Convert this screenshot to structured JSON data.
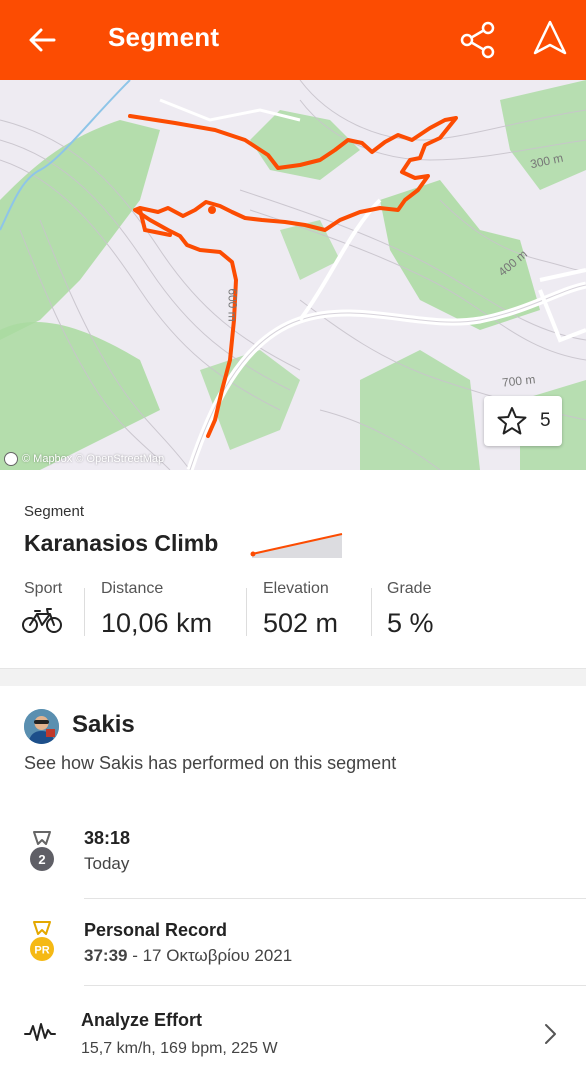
{
  "header": {
    "title": "Segment",
    "back_icon": "arrow-left-icon",
    "share_icon": "share-icon",
    "navigate_icon": "navigation-arrow-icon",
    "bg_color": "#fc4c02"
  },
  "map": {
    "contour_labels": [
      "300 m",
      "400 m",
      "600 m",
      "700 m"
    ],
    "attribution": "© Mapbox © OpenStreetMap",
    "star_count": "5",
    "route_color": "#fc4c02"
  },
  "segment": {
    "label": "Segment",
    "name": "Karanasios Climb",
    "stats": [
      {
        "label": "Sport",
        "value": ""
      },
      {
        "label": "Distance",
        "value": "10,06 km"
      },
      {
        "label": "Elevation",
        "value": "502 m"
      },
      {
        "label": "Grade",
        "value": "5 %"
      }
    ],
    "sport_icon": "bicycle-icon"
  },
  "athlete": {
    "name": "Sakis",
    "subtitle": "See how Sakis has performed on this segment"
  },
  "efforts": [
    {
      "icon": "rank-2-medal-icon",
      "badge": "2",
      "title": "38:18",
      "subtitle": "Today"
    },
    {
      "icon": "pr-medal-icon",
      "badge": "PR",
      "title": "Personal Record",
      "time": "37:39",
      "date": " - 17 Οκτωβρίου 2021"
    },
    {
      "icon": "heart-rate-icon",
      "title": "Analyze Effort",
      "subtitle": "15,7 km/h, 169 bpm, 225 W"
    }
  ]
}
